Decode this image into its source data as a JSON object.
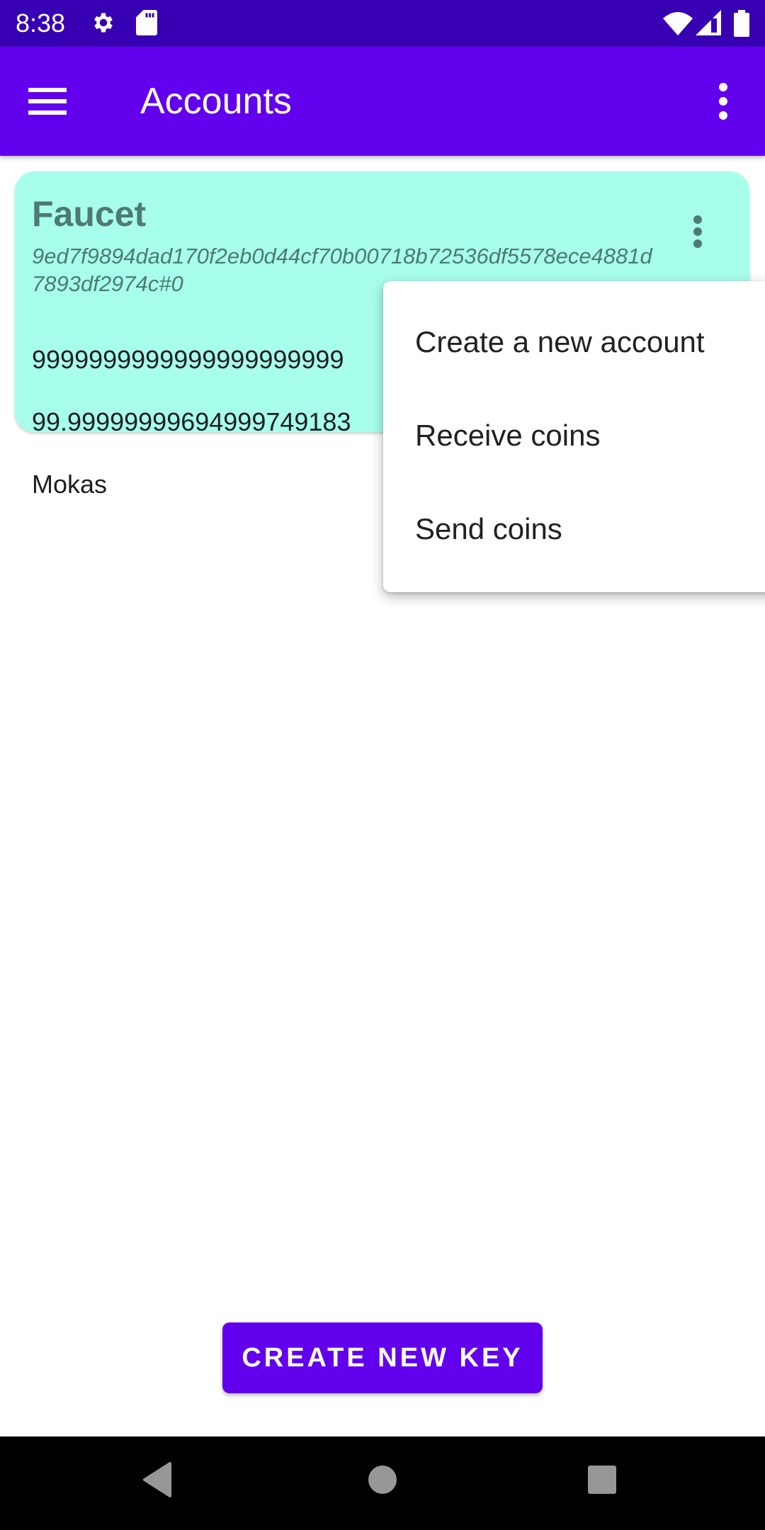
{
  "status_bar": {
    "time": "8:38",
    "left_icons": [
      "gear-icon",
      "sd-card-icon"
    ],
    "right_icons": [
      "wifi-icon",
      "cell-signal-icon",
      "battery-icon"
    ]
  },
  "app_bar": {
    "title": "Accounts",
    "nav_icon": "hamburger-menu-icon",
    "overflow_icon": "more-vert-icon"
  },
  "account_card": {
    "name": "Faucet",
    "address": "9ed7f9894dad170f2eb0d44cf70b00718b72536df5578ece4881d7893df2974c#0",
    "balance_line1": "9999999999999999999999",
    "balance_line2": "99.99999999694999749183",
    "currency": "Mokas",
    "background_color": "#a7ffeb"
  },
  "popup_menu": {
    "items": [
      {
        "label": "Create a new account"
      },
      {
        "label": "Receive coins"
      },
      {
        "label": "Send coins"
      }
    ]
  },
  "create_key_button": {
    "label": "CREATE NEW KEY"
  },
  "theme": {
    "primary": "#6200ee",
    "primary_dark": "#3700b3",
    "card_text": "#4e7a70"
  },
  "nav_bar": {
    "buttons": [
      "back-icon",
      "home-icon",
      "recents-icon"
    ]
  }
}
